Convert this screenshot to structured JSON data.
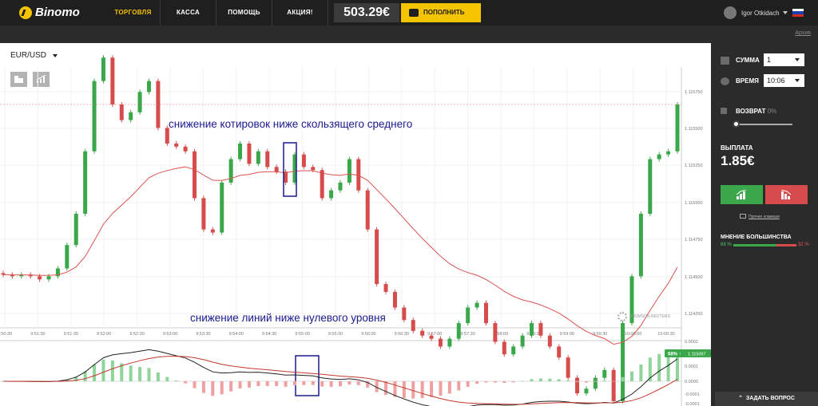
{
  "app": {
    "name": "Binomo"
  },
  "nav": [
    {
      "label": "ТОРГОВЛЯ",
      "active": true
    },
    {
      "label": "КАССА",
      "active": false
    },
    {
      "label": "ПОМОЩЬ",
      "active": false
    },
    {
      "label": "АКЦИЯ!",
      "active": false
    }
  ],
  "balance": "503.29€",
  "deposit_label": "ПОПОЛНИТЬ",
  "user": {
    "name": "Igor Otkidach"
  },
  "archive_label": "Архив",
  "chart": {
    "pair": "EUR/USD",
    "annotation_top": "снижение котировок ниже скользящего среднего",
    "annotation_bottom": "снижение линий ниже нулевого уровня",
    "provider": "THOMSON REUTERS"
  },
  "side": {
    "amount_label": "СУММА",
    "amount_value": "1",
    "time_label": "ВРЕМЯ",
    "time_value": "10:06",
    "refund_label": "ВОЗВРАТ",
    "refund_value": "0%",
    "payout_label": "ВЫПЛАТА",
    "payout_value": "1.85€",
    "tutorial_link": "Прочие клавиши",
    "majority_label": "МНЕНИЕ БОЛЬШИНСТВА",
    "majority_up": "68 %",
    "majority_down": "32 %",
    "majority_up_fraction": 0.68
  },
  "ask_label": "ЗАДАТЬ ВОПРОС",
  "colors": {
    "up": "#3aa84a",
    "down": "#d64c4c",
    "accent": "#f5c400",
    "ma": "#d9534f"
  },
  "chart_data": {
    "type": "candlestick",
    "x_ticks": [
      "9:50:30",
      "9:51:00",
      "9:51:30",
      "9:52:00",
      "9:52:30",
      "9:53:00",
      "9:53:30",
      "9:54:00",
      "9:54:30",
      "9:55:00",
      "9:55:30",
      "9:56:00",
      "9:56:30",
      "9:57:00",
      "9:57:30",
      "9:58:00",
      "9:58:30",
      "9:59:00",
      "9:59:30",
      "10:00:00",
      "10:00:30"
    ],
    "y_ticks": [
      "1.115750",
      "1.115500",
      "1.115250",
      "1.115000",
      "1.114750",
      "1.114500",
      "1.114250"
    ],
    "ylim": [
      1.11418,
      1.11584
    ],
    "current_price": "1.115097",
    "current_badge": "68% ↑",
    "osc_ticks": [
      "0.0002",
      "0.0001",
      "0.0001",
      "0.0000",
      "-0.0001",
      "-0.0001"
    ],
    "candles": [
      [
        1.11452,
        1.11451
      ],
      [
        1.11451,
        1.1145
      ],
      [
        1.1145,
        1.11451
      ],
      [
        1.11451,
        1.1145
      ],
      [
        1.1145,
        1.11448
      ],
      [
        1.11448,
        1.1145
      ],
      [
        1.1145,
        1.11455
      ],
      [
        1.11455,
        1.1147
      ],
      [
        1.1147,
        1.1149
      ],
      [
        1.1149,
        1.1153
      ],
      [
        1.1153,
        1.11575
      ],
      [
        1.11575,
        1.1159
      ],
      [
        1.1159,
        1.1156
      ],
      [
        1.1156,
        1.1155
      ],
      [
        1.1155,
        1.11555
      ],
      [
        1.11555,
        1.11568
      ],
      [
        1.11568,
        1.11575
      ],
      [
        1.11575,
        1.11545
      ],
      [
        1.11545,
        1.11535
      ],
      [
        1.11535,
        1.11533
      ],
      [
        1.11533,
        1.1153
      ],
      [
        1.1153,
        1.115
      ],
      [
        1.115,
        1.1148
      ],
      [
        1.1148,
        1.11478
      ],
      [
        1.11478,
        1.1151
      ],
      [
        1.1151,
        1.11525
      ],
      [
        1.11525,
        1.11535
      ],
      [
        1.11535,
        1.11522
      ],
      [
        1.11522,
        1.1153
      ],
      [
        1.1153,
        1.1152
      ],
      [
        1.1152,
        1.11517
      ],
      [
        1.11517,
        1.1151
      ],
      [
        1.1151,
        1.11528
      ],
      [
        1.11528,
        1.1152
      ],
      [
        1.1152,
        1.11518
      ],
      [
        1.11518,
        1.115
      ],
      [
        1.115,
        1.11505
      ],
      [
        1.11505,
        1.1151
      ],
      [
        1.1151,
        1.11525
      ],
      [
        1.11525,
        1.11505
      ],
      [
        1.11505,
        1.1148
      ],
      [
        1.1148,
        1.11445
      ],
      [
        1.11445,
        1.1144
      ],
      [
        1.1144,
        1.1143
      ],
      [
        1.1143,
        1.11422
      ],
      [
        1.11422,
        1.11415
      ],
      [
        1.11415,
        1.11412
      ],
      [
        1.11412,
        1.1141
      ],
      [
        1.1141,
        1.11405
      ],
      [
        1.11405,
        1.1141
      ],
      [
        1.1141,
        1.1142
      ],
      [
        1.1142,
        1.1143
      ],
      [
        1.1143,
        1.11433
      ],
      [
        1.11433,
        1.1142
      ],
      [
        1.1142,
        1.11408
      ],
      [
        1.11408,
        1.114
      ],
      [
        1.114,
        1.11405
      ],
      [
        1.11405,
        1.11412
      ],
      [
        1.11412,
        1.1142
      ],
      [
        1.1142,
        1.11412
      ],
      [
        1.11412,
        1.11405
      ],
      [
        1.11405,
        1.11398
      ],
      [
        1.11398,
        1.11385
      ],
      [
        1.11385,
        1.11375
      ],
      [
        1.11375,
        1.11378
      ],
      [
        1.11378,
        1.11385
      ],
      [
        1.11385,
        1.1139
      ],
      [
        1.1139,
        1.1137
      ],
      [
        1.1137,
        1.1142
      ],
      [
        1.1142,
        1.1145
      ],
      [
        1.1145,
        1.1149
      ],
      [
        1.1149,
        1.11525
      ],
      [
        1.11525,
        1.11528
      ],
      [
        1.11528,
        1.1153
      ],
      [
        1.1153,
        1.1156
      ]
    ]
  }
}
